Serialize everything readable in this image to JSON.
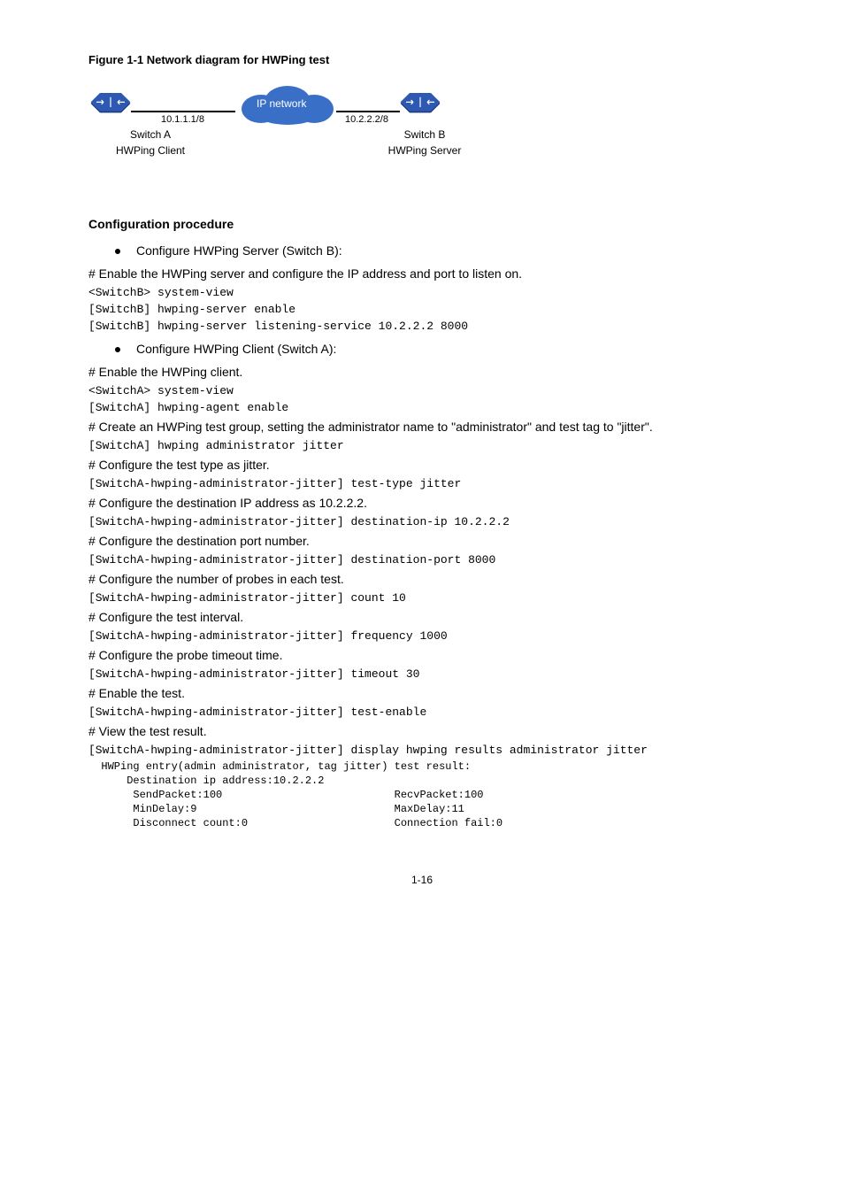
{
  "figure_title": "Figure 1-1 Network diagram for HWPing test",
  "diagram": {
    "ip_left": "10.1.1.1/8",
    "ip_right": "10.2.2.2/8",
    "cloud_label": "IP network",
    "nodeA_name": "Switch A",
    "nodeA_role": "HWPing Client",
    "nodeB_name": "Switch B",
    "nodeB_role": "HWPing Server"
  },
  "proc_heading": "Configuration procedure",
  "bullets": {
    "b1": "Configure HWPing Server (Switch B):",
    "b2": "Configure HWPing Client (Switch A):"
  },
  "cfgB": {
    "c1": "# Enable the HWPing server and configure the IP address and port to listen on.",
    "cmd1": "<SwitchB> system-view",
    "cmd2": "[SwitchB] hwping-server enable",
    "cmd3": "[SwitchB] hwping-server listening-service 10.2.2.2 8000"
  },
  "cfgA": {
    "c1": "# Enable the HWPing client.",
    "cmd1": "<SwitchA> system-view",
    "cmd2": "[SwitchA] hwping-agent enable",
    "c2": "# Create an HWPing test group, setting the administrator name to \"administrator\" and test tag to \"jitter\".",
    "cmd3": "[SwitchA] hwping administrator jitter",
    "c3": "# Configure the test type as jitter.",
    "cmd4": "[SwitchA-hwping-administrator-jitter] test-type jitter",
    "c4": "# Configure the destination IP address as 10.2.2.2.",
    "cmd5": "[SwitchA-hwping-administrator-jitter] destination-ip 10.2.2.2",
    "c5": "# Configure the destination port number.",
    "cmd6": "[SwitchA-hwping-administrator-jitter] destination-port 8000",
    "c6": "# Configure the number of probes in each test.",
    "cmd7": "[SwitchA-hwping-administrator-jitter] count 10",
    "c7": "# Configure the test interval.",
    "cmd8": "[SwitchA-hwping-administrator-jitter] frequency 1000",
    "c8": "# Configure the probe timeout time.",
    "cmd9": "[SwitchA-hwping-administrator-jitter] timeout 30",
    "c9": "# Enable the test.",
    "cmd10": "[SwitchA-hwping-administrator-jitter] test-enable",
    "c10": "# View the test result.",
    "cmd11": "[SwitchA-hwping-administrator-jitter] display hwping results administrator jitter",
    "out1": "  HWPing entry(admin administrator, tag jitter) test result:",
    "out2": "      Destination ip address:10.2.2.2",
    "out3": "       SendPacket:100                           RecvPacket:100",
    "out4": "       MinDelay:9                               MaxDelay:11",
    "out5": "       Disconnect count:0                       Connection fail:0"
  },
  "page_number": "1-16"
}
